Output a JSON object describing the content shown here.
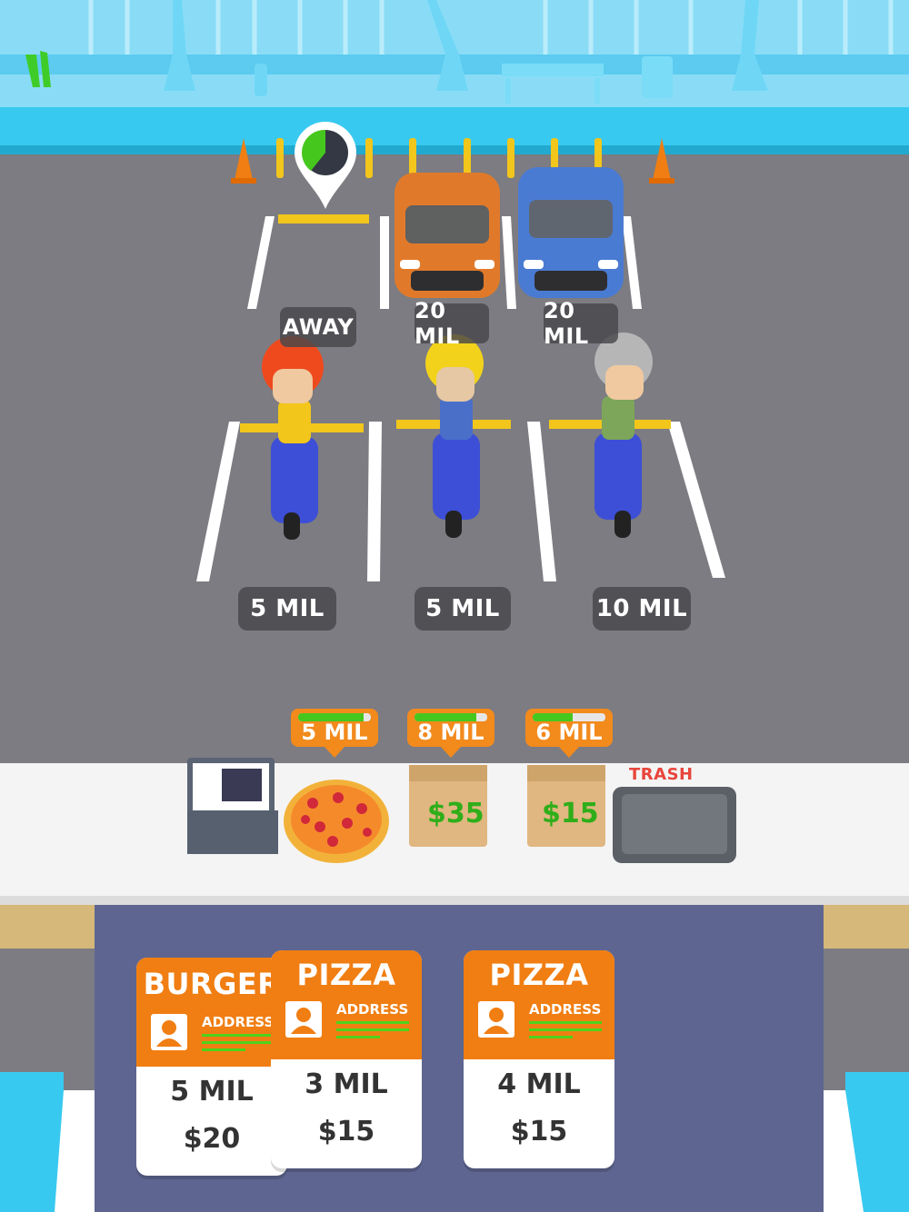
{
  "parking": {
    "top_spots": [
      {
        "label": "AWAY"
      },
      {
        "label": "20 MIL"
      },
      {
        "label": "20 MIL"
      }
    ],
    "bike_spots": [
      {
        "label": "5 MIL"
      },
      {
        "label": "5 MIL"
      },
      {
        "label": "10 MIL"
      }
    ]
  },
  "counter": {
    "items": [
      {
        "type": "pizza",
        "distance": "5 MIL",
        "progress": 0.9
      },
      {
        "type": "bag",
        "distance": "8 MIL",
        "progress": 0.85,
        "price": "$35"
      },
      {
        "type": "bag",
        "distance": "6 MIL",
        "progress": 0.55,
        "price": "$15"
      }
    ],
    "trash_label": "TRASH"
  },
  "orders": [
    {
      "dish": "BURGER",
      "address": "ADDRESS",
      "distance": "5 MIL",
      "price": "$20"
    },
    {
      "dish": "PIZZA",
      "address": "ADDRESS",
      "distance": "3 MIL",
      "price": "$15"
    },
    {
      "dish": "PIZZA",
      "address": "ADDRESS",
      "distance": "4 MIL",
      "price": "$15"
    }
  ],
  "colors": {
    "orange": "#f07e12",
    "panel": "#5e6590",
    "road": "#7c7c82",
    "sidewalk": "#38c9f0",
    "green": "#46c71e"
  }
}
